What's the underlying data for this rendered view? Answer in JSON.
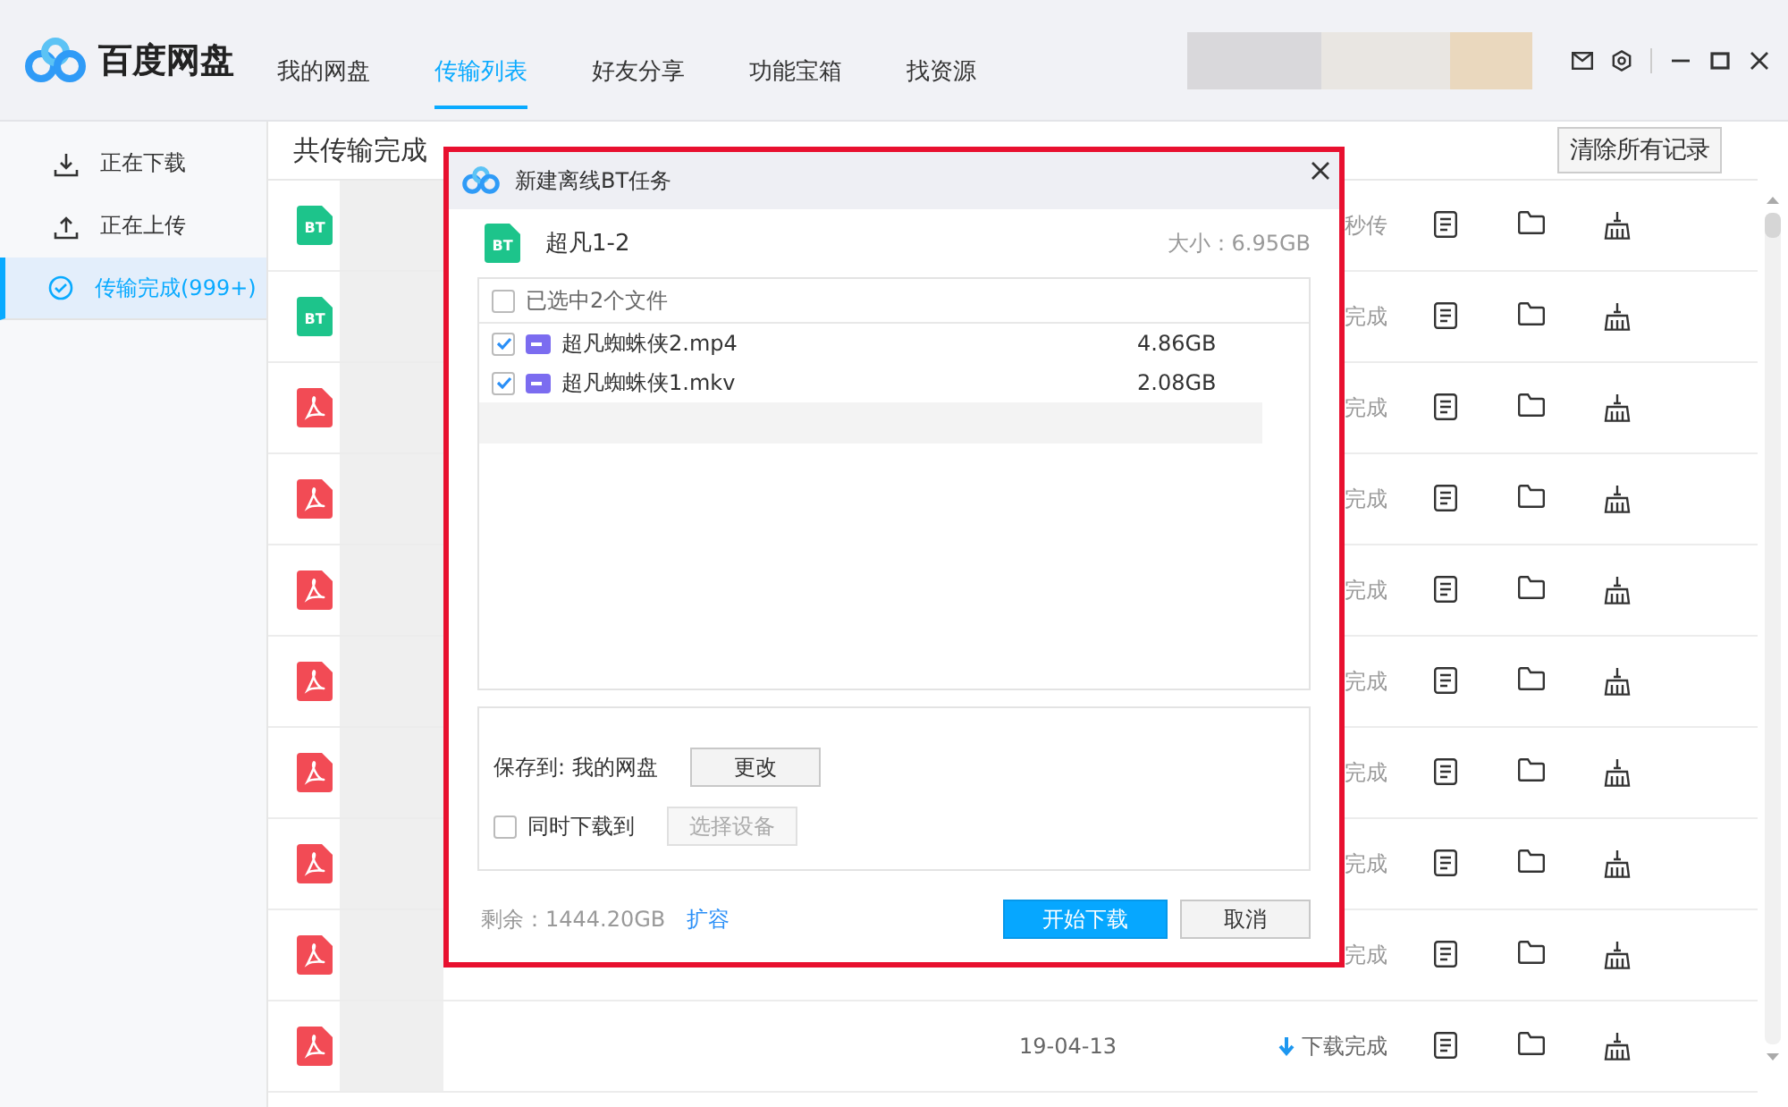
{
  "app": {
    "logo": "百度网盘"
  },
  "nav": [
    {
      "label": "我的网盘",
      "selected": false
    },
    {
      "label": "传输列表",
      "selected": true
    },
    {
      "label": "好友分享",
      "selected": false
    },
    {
      "label": "功能宝箱",
      "selected": false
    },
    {
      "label": "找资源",
      "selected": false
    }
  ],
  "sidebar": {
    "items": [
      {
        "label": "正在下载",
        "kind": "download",
        "selected": false
      },
      {
        "label": "正在上传",
        "kind": "upload",
        "selected": false
      },
      {
        "label": "传输完成(999+)",
        "kind": "done",
        "selected": true
      }
    ]
  },
  "list": {
    "summary": "共传输完成",
    "clear_button": "清除所有记录",
    "rows": [
      {
        "kind": "bt",
        "badge": "BT",
        "status": "秒传"
      },
      {
        "kind": "bt",
        "badge": "BT",
        "status": "完成"
      },
      {
        "kind": "pdf",
        "status": "完成"
      },
      {
        "kind": "pdf",
        "status": "完成"
      },
      {
        "kind": "pdf",
        "status": "完成"
      },
      {
        "kind": "pdf",
        "status": "完成"
      },
      {
        "kind": "pdf",
        "status": "完成"
      },
      {
        "kind": "pdf",
        "status": "完成"
      },
      {
        "kind": "pdf",
        "status": "完成"
      },
      {
        "kind": "pdf",
        "date": "19-04-13",
        "status": "下载完成",
        "downloaded": true
      }
    ]
  },
  "dialog": {
    "title": "新建离线BT任务",
    "torrent": {
      "badge": "BT",
      "name": "超凡1-2",
      "size": "大小：6.95GB"
    },
    "select_all": {
      "label": "已选中2个文件",
      "checked": false
    },
    "files": [
      {
        "name": "超凡蜘蛛侠2.mp4",
        "size": "4.86GB",
        "checked": true
      },
      {
        "name": "超凡蜘蛛侠1.mkv",
        "size": "2.08GB",
        "checked": true
      }
    ],
    "save_to": "保存到: 我的网盘",
    "change_button": "更改",
    "also_download": {
      "label": "同时下载到",
      "checked": false
    },
    "device_button": {
      "label": "选择设备",
      "disabled": true
    },
    "remaining": "剩余：1444.20GB",
    "expand_link": "扩容",
    "start_button": "开始下载",
    "cancel_button": "取消"
  }
}
